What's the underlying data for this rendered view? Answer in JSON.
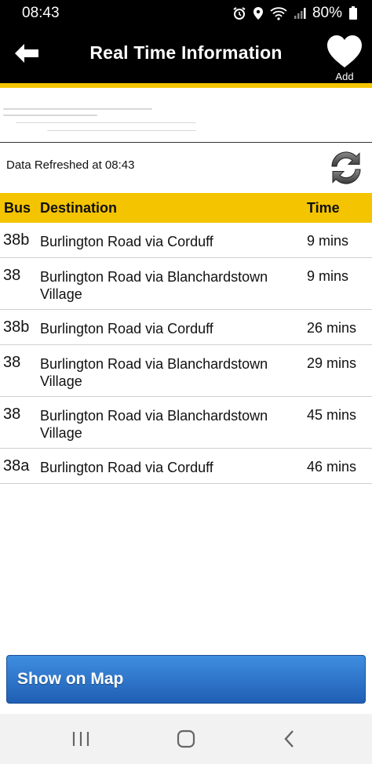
{
  "status_bar": {
    "time": "08:43",
    "battery": "80%"
  },
  "app_bar": {
    "title": "Real Time Information",
    "add_label": "Add"
  },
  "refresh": {
    "text": "Data Refreshed at 08:43"
  },
  "table": {
    "headers": {
      "bus": "Bus",
      "destination": "Destination",
      "time": "Time"
    },
    "rows": [
      {
        "bus": "38b",
        "destination": "Burlington Road via Corduff",
        "time": "9 mins"
      },
      {
        "bus": "38",
        "destination": "Burlington Road via Blanchardstown Village",
        "time": "9 mins"
      },
      {
        "bus": "38b",
        "destination": "Burlington Road via Corduff",
        "time": "26 mins"
      },
      {
        "bus": "38",
        "destination": "Burlington Road via Blanchardstown Village",
        "time": "29 mins"
      },
      {
        "bus": "38",
        "destination": "Burlington Road via Blanchardstown Village",
        "time": "45 mins"
      },
      {
        "bus": "38a",
        "destination": "Burlington Road via Corduff",
        "time": "46 mins"
      }
    ]
  },
  "map_button": {
    "label": "Show on Map"
  },
  "colors": {
    "accent": "#f4c400",
    "appbar": "#000000",
    "button": "#2f74c8"
  },
  "icons": [
    "alarm-icon",
    "location-icon",
    "wifi-icon",
    "signal-icon",
    "battery-icon",
    "back-arrow-icon",
    "heart-icon",
    "refresh-icon",
    "recents-icon",
    "home-icon",
    "nav-back-icon"
  ]
}
